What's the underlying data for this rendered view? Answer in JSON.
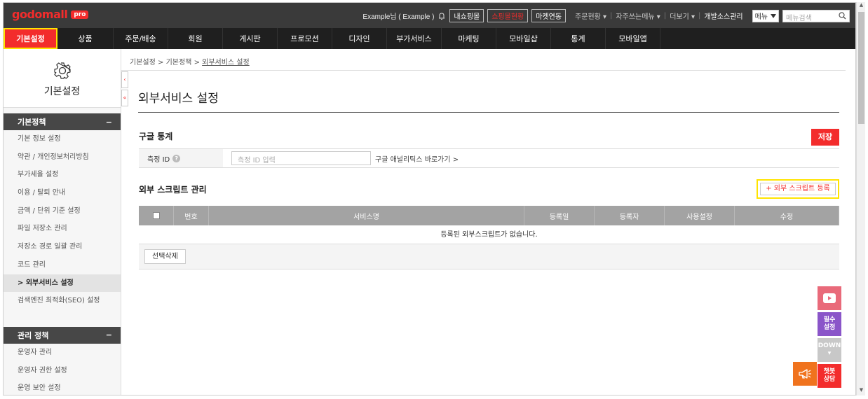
{
  "topbar": {
    "logo_text": "godomall",
    "logo_badge": "pro",
    "user_text": "Example님 ( Example )",
    "btn_myshop": "내쇼핑몰",
    "btn_shop_status": "쇼핑몰현황",
    "btn_market": "마켓연동",
    "link_order_status": "주문현황 ▾",
    "link_frequent_menu": "자주쓰는메뉴 ▾",
    "link_more": "더보기 ▾",
    "link_dev_source": "개발소스관리",
    "menu_select": "메뉴",
    "menu_search_placeholder": "메뉴검색"
  },
  "nav": {
    "items": [
      {
        "label": "기본설정",
        "active": true
      },
      {
        "label": "상품"
      },
      {
        "label": "주문/배송"
      },
      {
        "label": "회원"
      },
      {
        "label": "게시판"
      },
      {
        "label": "프로모션"
      },
      {
        "label": "디자인"
      },
      {
        "label": "부가서비스"
      },
      {
        "label": "마케팅"
      },
      {
        "label": "모바일샵"
      },
      {
        "label": "통계"
      },
      {
        "label": "모바일앱"
      }
    ]
  },
  "sidebar": {
    "title": "기본설정",
    "section1": {
      "label": "기본정책",
      "toggle": "−",
      "items": [
        "기본 정보 설정",
        "약관 / 개인정보처리방침",
        "부가세율 설정",
        "이용 / 탈퇴 안내",
        "금액 / 단위 기준 설정",
        "파일 저장소 관리",
        "저장소 경로 일괄 관리",
        "코드 관리",
        "> 외부서비스 설정",
        "검색엔진 최적화(SEO) 설정"
      ],
      "selected_index": 8
    },
    "section2": {
      "label": "관리 정책",
      "toggle": "−",
      "items": [
        "운영자 관리",
        "운영자 권한 설정",
        "운영 보안 설정"
      ]
    }
  },
  "content": {
    "breadcrumb": [
      "기본설정",
      "기본정책",
      "외부서비스 설정"
    ],
    "page_title": "외부서비스 설정",
    "ga_section_title": "구글 통계",
    "save_label": "저장",
    "measure_id_label": "측정 ID",
    "measure_id_placeholder": "측정 ID 입력",
    "ga_shortcut": "구글 애널리틱스 바로가기 >",
    "script_section_title": "외부 스크립트 관리",
    "add_script_label": "+ 외부 스크립트 등록",
    "table_headers": [
      "번호",
      "서비스명",
      "등록일",
      "등록자",
      "사용설정",
      "수정"
    ],
    "empty_message": "등록된 외부스크립트가 없습니다.",
    "delete_selected_label": "선택삭제"
  },
  "floating": {
    "youtube": "youtube-icon",
    "required_settings": [
      "필수",
      "설정"
    ],
    "down": "DOWN",
    "chat": [
      "챗봇",
      "상담"
    ]
  },
  "colors": {
    "brand_red": "#f32c2c",
    "highlight_yellow": "#ffe400",
    "topbar": "#3a3a3a",
    "nav": "#1f1f1f"
  }
}
